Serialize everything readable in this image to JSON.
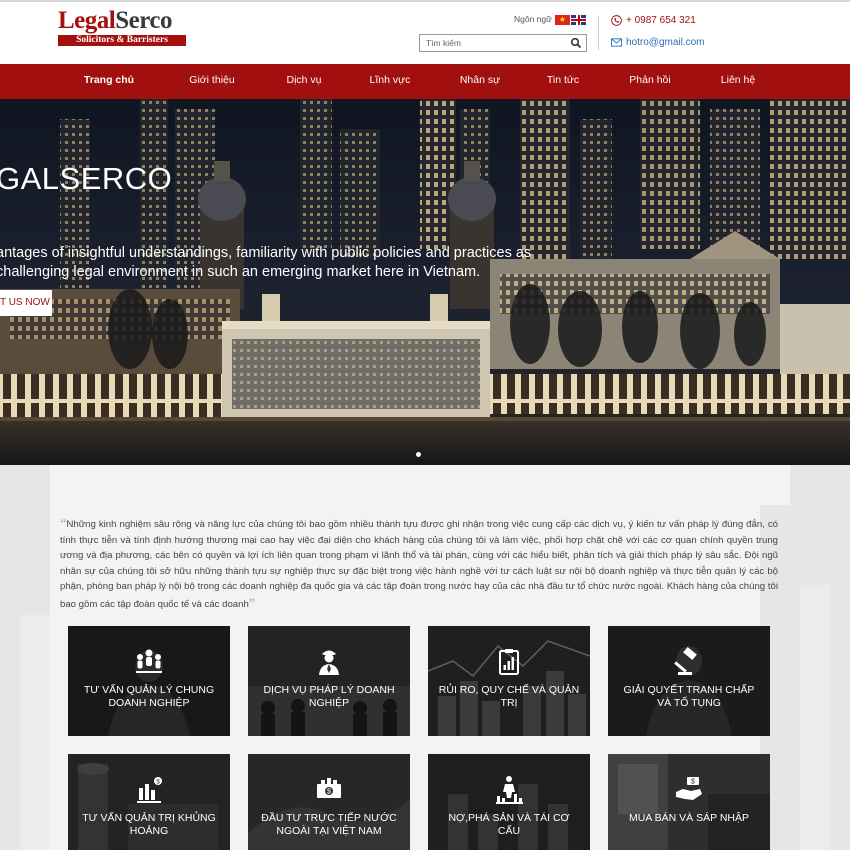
{
  "header": {
    "logo": {
      "name_red": "Legal",
      "name_dark": "Serco",
      "tagline": "Solicitors & Barristers"
    },
    "language_label": "Ngôn ngữ :",
    "search": {
      "placeholder": "Tìm kiếm",
      "value": ""
    },
    "phone": "+ 0987 654 321",
    "email": "hotro@gmail.com"
  },
  "nav": {
    "items": [
      {
        "label": "Trang chủ",
        "active": true
      },
      {
        "label": "Giới thiệu"
      },
      {
        "label": "Dịch vụ"
      },
      {
        "label": "Lĩnh vực"
      },
      {
        "label": "Nhân sự"
      },
      {
        "label": "Tin tức"
      },
      {
        "label": "Phản hồi"
      },
      {
        "label": "Liên hệ"
      }
    ]
  },
  "hero": {
    "title": "GALSERCO",
    "text": "antages of insightful understandings, familiarity with public policies and practices as challenging legal environment in such an emerging market here in Vietnam.",
    "button": "T US NOW"
  },
  "intro": {
    "text": "Những kinh nghiệm sâu rộng và năng lực  của chúng tôi bao gồm nhiều thành tựu được ghi nhận trong việc cung cấp các dịch vụ, ý kiến tư vấn pháp lý đúng đắn, có tính thực tiễn và tính định hướng thương mại cao hay việc đại diện cho khách hàng của chúng tôi và làm việc, phối hợp chặt chẽ với các cơ quan chính quyền trung ương và địa phương, các bên có quyền và lợi ích liên quan trong phạm vi lãnh thổ và tài phán, cùng với các hiểu biết, phân tích và giải thích pháp lý sâu sắc. Đội ngũ nhân sự của chúng tôi sở hữu những thành tựu sự nghiệp thực sự đặc biệt  trong việc hành nghề với tư cách luật sư nội bộ doanh nghiệp và thực tiễn quản lý các bộ phận, phòng ban pháp lý nội bộ trong các doanh nghiệp  đa quốc gia và các tập đoàn trong nước hay của các nhà đầu tư tổ chức nước ngoài. Khách hàng của chúng tôi bao gồm các tập đoàn quốc tế và các doanh"
  },
  "services": [
    {
      "label": "Tư vấn quản lý chung doanh nghiệp",
      "icon": "group-people-icon"
    },
    {
      "label": "Dịch vụ pháp lý doanh nghiệp",
      "icon": "lawyer-icon"
    },
    {
      "label": "Rủi ro, quy chế và quản trị",
      "icon": "clipboard-chart-icon"
    },
    {
      "label": "Giải quyết tranh chấp và tố tụng",
      "icon": "gavel-icon"
    },
    {
      "label": "Tư vấn quản trị khủng hoảng",
      "icon": "bar-chart-icon"
    },
    {
      "label": "Đầu tư trực tiếp nước ngoài tại Việt Nam",
      "icon": "money-icon"
    },
    {
      "label": "Nợ,phá sản và tái cơ cấu",
      "icon": "falling-chart-icon"
    },
    {
      "label": "Mua bán và sáp nhập",
      "icon": "handshake-icon"
    }
  ],
  "colors": {
    "brand": "#a10f0e",
    "link": "#2a6fbe"
  }
}
